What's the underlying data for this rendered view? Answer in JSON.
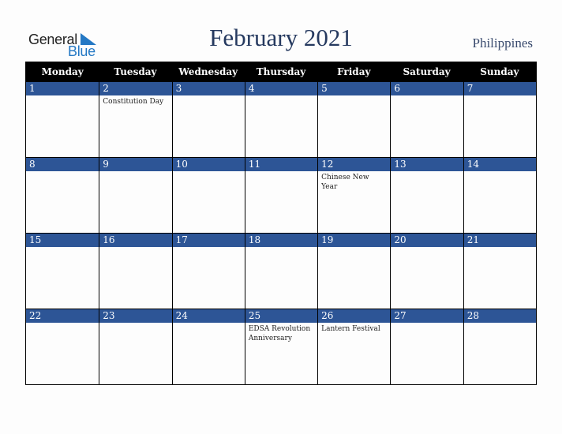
{
  "logo": {
    "line1": "General",
    "line2": "Blue"
  },
  "header": {
    "title": "February 2021",
    "country": "Philippines"
  },
  "colors": {
    "accent": "#2d5596",
    "title": "#25395f",
    "logo_blue": "#2478c4"
  },
  "weekdays": [
    "Monday",
    "Tuesday",
    "Wednesday",
    "Thursday",
    "Friday",
    "Saturday",
    "Sunday"
  ],
  "weeks": [
    [
      {
        "day": "1",
        "event": ""
      },
      {
        "day": "2",
        "event": "Constitution Day"
      },
      {
        "day": "3",
        "event": ""
      },
      {
        "day": "4",
        "event": ""
      },
      {
        "day": "5",
        "event": ""
      },
      {
        "day": "6",
        "event": ""
      },
      {
        "day": "7",
        "event": ""
      }
    ],
    [
      {
        "day": "8",
        "event": ""
      },
      {
        "day": "9",
        "event": ""
      },
      {
        "day": "10",
        "event": ""
      },
      {
        "day": "11",
        "event": ""
      },
      {
        "day": "12",
        "event": "Chinese New Year"
      },
      {
        "day": "13",
        "event": ""
      },
      {
        "day": "14",
        "event": ""
      }
    ],
    [
      {
        "day": "15",
        "event": ""
      },
      {
        "day": "16",
        "event": ""
      },
      {
        "day": "17",
        "event": ""
      },
      {
        "day": "18",
        "event": ""
      },
      {
        "day": "19",
        "event": ""
      },
      {
        "day": "20",
        "event": ""
      },
      {
        "day": "21",
        "event": ""
      }
    ],
    [
      {
        "day": "22",
        "event": ""
      },
      {
        "day": "23",
        "event": ""
      },
      {
        "day": "24",
        "event": ""
      },
      {
        "day": "25",
        "event": "EDSA Revolution Anniversary"
      },
      {
        "day": "26",
        "event": "Lantern Festival"
      },
      {
        "day": "27",
        "event": ""
      },
      {
        "day": "28",
        "event": ""
      }
    ]
  ]
}
